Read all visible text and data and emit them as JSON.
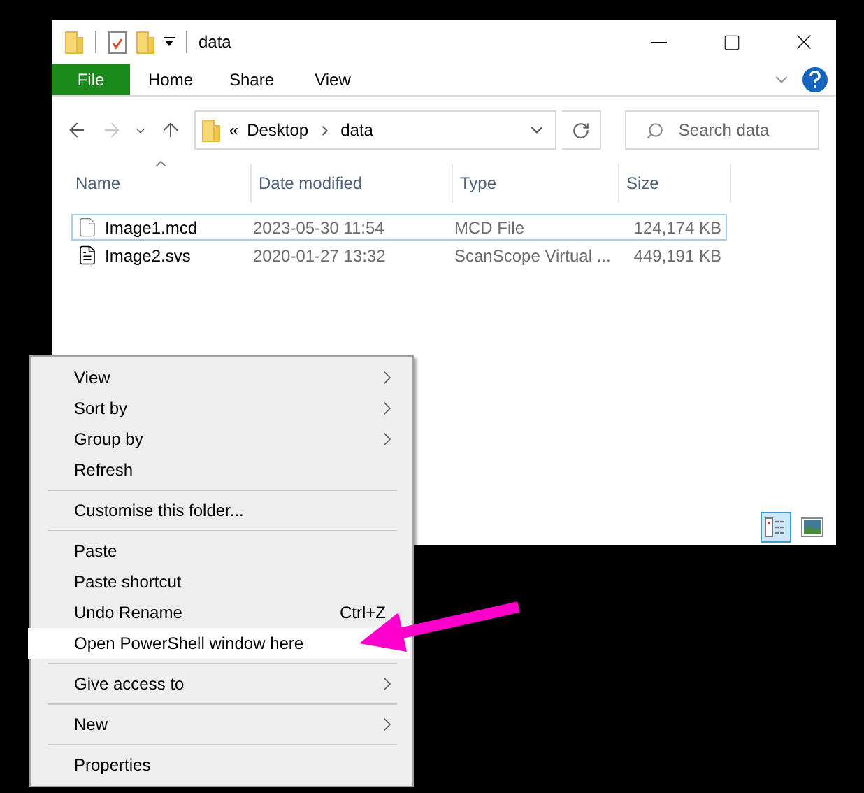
{
  "window": {
    "title": "data"
  },
  "ribbon": {
    "tabs": [
      {
        "label": "File",
        "kind": "file"
      },
      {
        "label": "Home",
        "kind": "tab"
      },
      {
        "label": "Share",
        "kind": "tab"
      },
      {
        "label": "View",
        "kind": "tab"
      }
    ]
  },
  "navigation": [
    {
      "kind": "back",
      "disabled": false
    },
    {
      "kind": "forward",
      "disabled": true
    },
    {
      "kind": "recent",
      "disabled": false
    },
    {
      "kind": "up",
      "disabled": false
    }
  ],
  "address": {
    "overflow": "«",
    "crumbs": [
      "Desktop",
      "data"
    ]
  },
  "search": {
    "placeholder": "Search data"
  },
  "table": {
    "columns": [
      {
        "label": "Name",
        "sorted": true
      },
      {
        "label": "Date modified",
        "sorted": false
      },
      {
        "label": "Type",
        "sorted": false
      },
      {
        "label": "Size",
        "sorted": false
      }
    ],
    "rows": [
      {
        "name": "Image1.mcd",
        "kind": "blank",
        "date": "2023-05-30 11:54",
        "type": "MCD File",
        "size": "124,174 KB",
        "selected": true
      },
      {
        "name": "Image2.svs",
        "kind": "document",
        "date": "2020-01-27 13:32",
        "type": "ScanScope Virtual ...",
        "size": "449,191 KB",
        "selected": false
      }
    ]
  },
  "view_buttons": [
    {
      "kind": "details",
      "selected": true
    },
    {
      "kind": "large_icons",
      "selected": false
    }
  ],
  "context_menu": {
    "sections": [
      {
        "items": [
          {
            "label": "View",
            "submenu": true,
            "selected": false
          },
          {
            "label": "Sort by",
            "submenu": true,
            "selected": false
          },
          {
            "label": "Group by",
            "submenu": true,
            "selected": false
          },
          {
            "label": "Refresh",
            "submenu": false,
            "selected": false
          }
        ]
      },
      {
        "items": [
          {
            "label": "Customise this folder...",
            "submenu": false,
            "selected": false
          }
        ]
      },
      {
        "items": [
          {
            "label": "Paste",
            "submenu": false,
            "selected": false
          },
          {
            "label": "Paste shortcut",
            "submenu": false,
            "selected": false
          },
          {
            "label": "Undo Rename",
            "shortcut": "Ctrl+Z",
            "submenu": false,
            "selected": false
          },
          {
            "label": "Open PowerShell window here",
            "submenu": false,
            "selected": true
          }
        ]
      },
      {
        "items": [
          {
            "label": "Give access to",
            "submenu": true,
            "selected": false
          }
        ]
      },
      {
        "items": [
          {
            "label": "New",
            "submenu": true,
            "selected": false
          }
        ]
      },
      {
        "items": [
          {
            "label": "Properties",
            "submenu": false,
            "selected": false
          }
        ]
      }
    ]
  }
}
